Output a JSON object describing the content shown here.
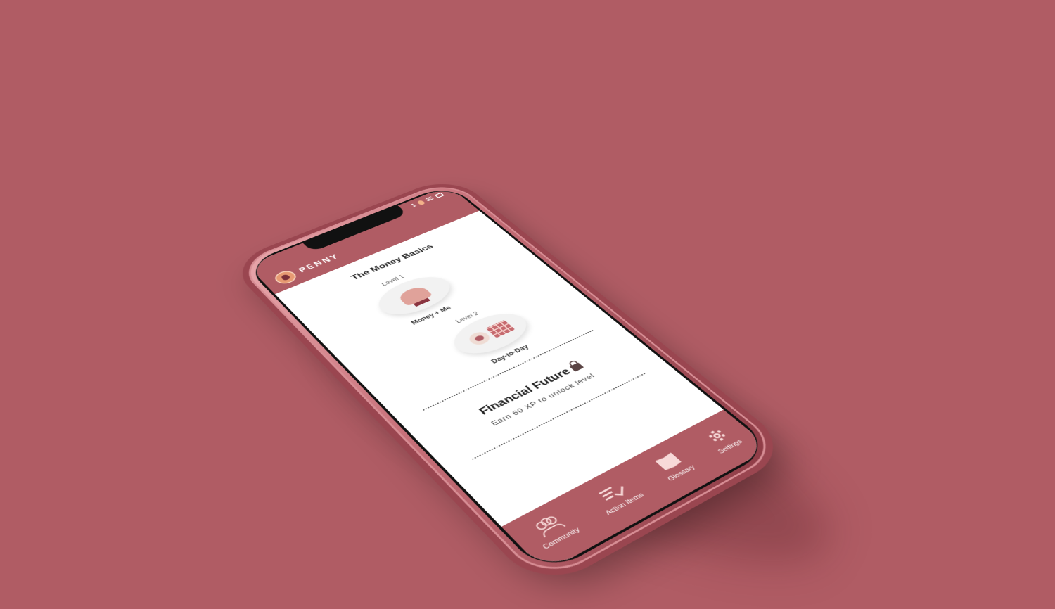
{
  "status": {
    "streak": "1",
    "coins": "35"
  },
  "brand": {
    "name": "PENNY"
  },
  "unit": {
    "title": "The Money Basics"
  },
  "levels": [
    {
      "label": "Level 1",
      "name": "Money + Me"
    },
    {
      "label": "Level 2",
      "name": "Day-to-Day"
    }
  ],
  "locked": {
    "title": "Financial Future",
    "message": "Earn 60 XP to unlock level"
  },
  "tabs": [
    {
      "label": "Community"
    },
    {
      "label": "Action Items"
    },
    {
      "label": "Glossary"
    },
    {
      "label": "Settings"
    }
  ],
  "colors": {
    "brand": "#b05c64",
    "background": "#b05c64",
    "screen": "#ffffff",
    "accent": "#e79a72"
  }
}
